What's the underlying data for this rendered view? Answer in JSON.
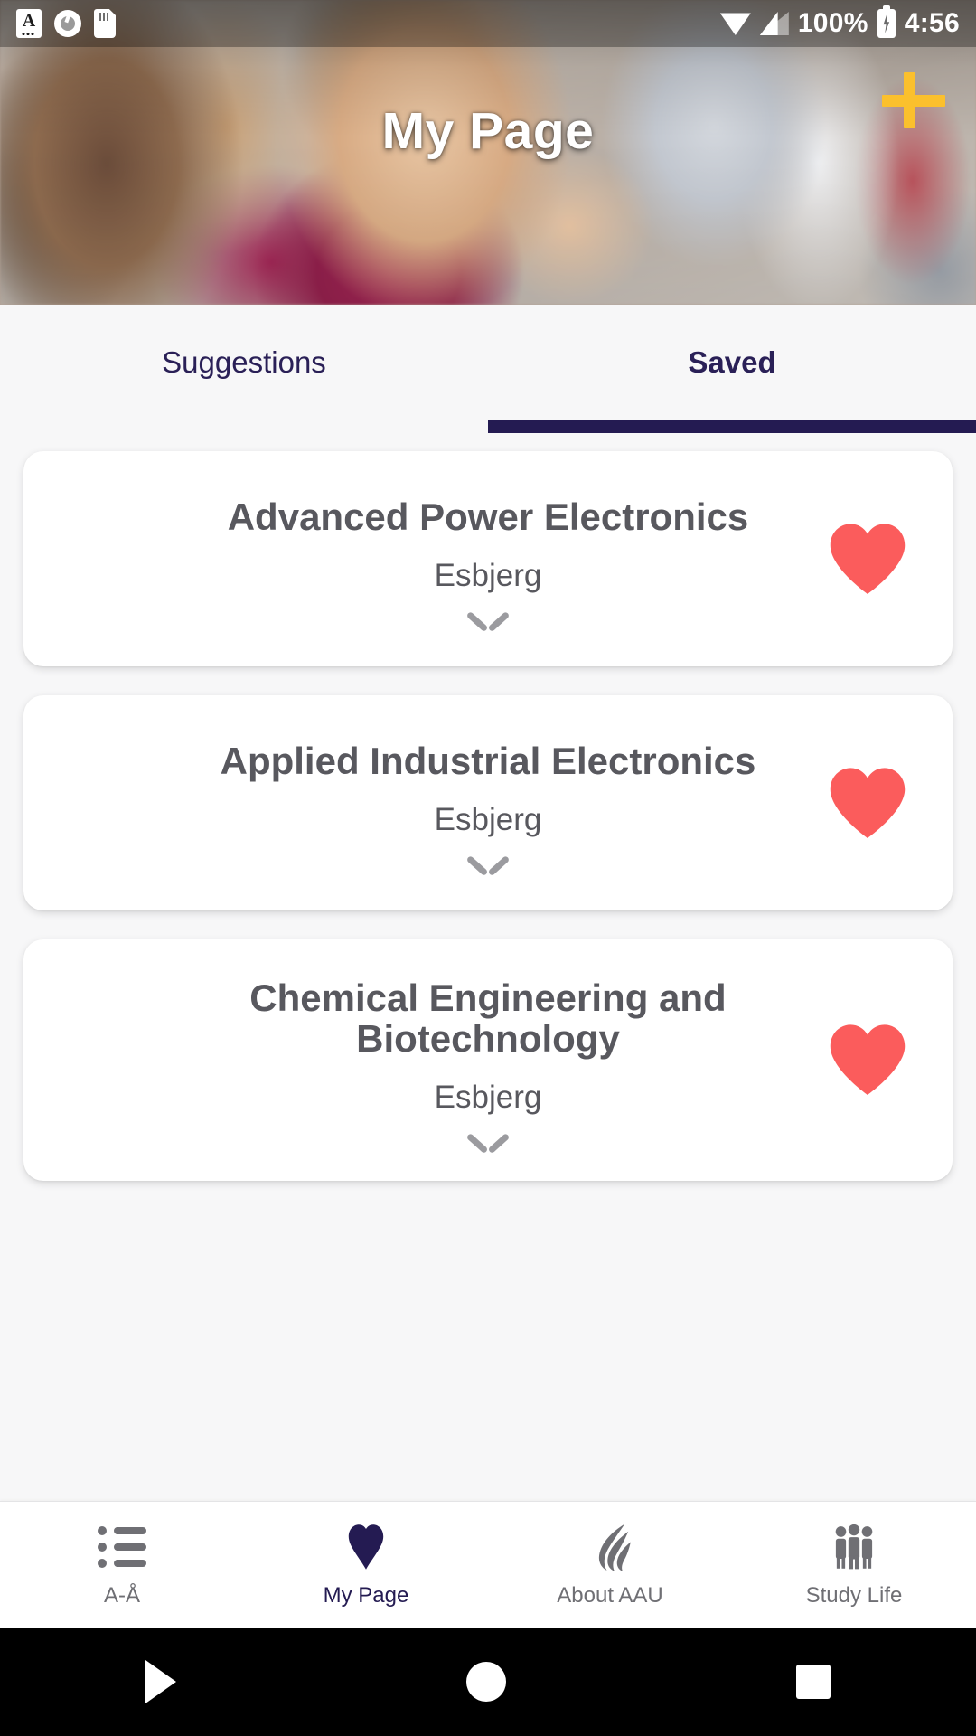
{
  "status_bar": {
    "icons_left": [
      "app-a-icon",
      "record-circle-icon",
      "sd-card-icon"
    ],
    "icons_right": [
      "wifi-icon",
      "cellular-signal-icon",
      "battery-charging-icon"
    ],
    "battery_percent": "100%",
    "time": "4:56"
  },
  "header": {
    "title": "My Page",
    "add_icon": "plus-icon",
    "accent_color": "#fbc02d"
  },
  "tabs": {
    "items": [
      {
        "label": "Suggestions",
        "active": false
      },
      {
        "label": "Saved",
        "active": true
      }
    ],
    "indicator_color": "#241b52"
  },
  "saved_list": {
    "favorite_icon": "heart-filled-icon",
    "expand_icon": "chevron-down-icon",
    "favorite_color": "#fb5c5c",
    "cards": [
      {
        "title": "Advanced Power Electronics",
        "campus": "Esbjerg",
        "favorited": true
      },
      {
        "title": "Applied Industrial Electronics",
        "campus": "Esbjerg",
        "favorited": true
      },
      {
        "title": "Chemical Engineering and Biotechnology",
        "campus": "Esbjerg",
        "favorited": true
      }
    ]
  },
  "bottom_nav": {
    "items": [
      {
        "label": "A-Å",
        "icon": "list-icon",
        "active": false
      },
      {
        "label": "My Page",
        "icon": "heart-icon",
        "active": true
      },
      {
        "label": "About AAU",
        "icon": "aau-flame-logo-icon",
        "active": false
      },
      {
        "label": "Study Life",
        "icon": "people-group-icon",
        "active": false
      }
    ],
    "active_color": "#241b52",
    "inactive_color": "#6f6f74"
  },
  "system_nav": {
    "back": "back-triangle-icon",
    "home": "home-circle-icon",
    "recents": "recents-square-icon"
  }
}
